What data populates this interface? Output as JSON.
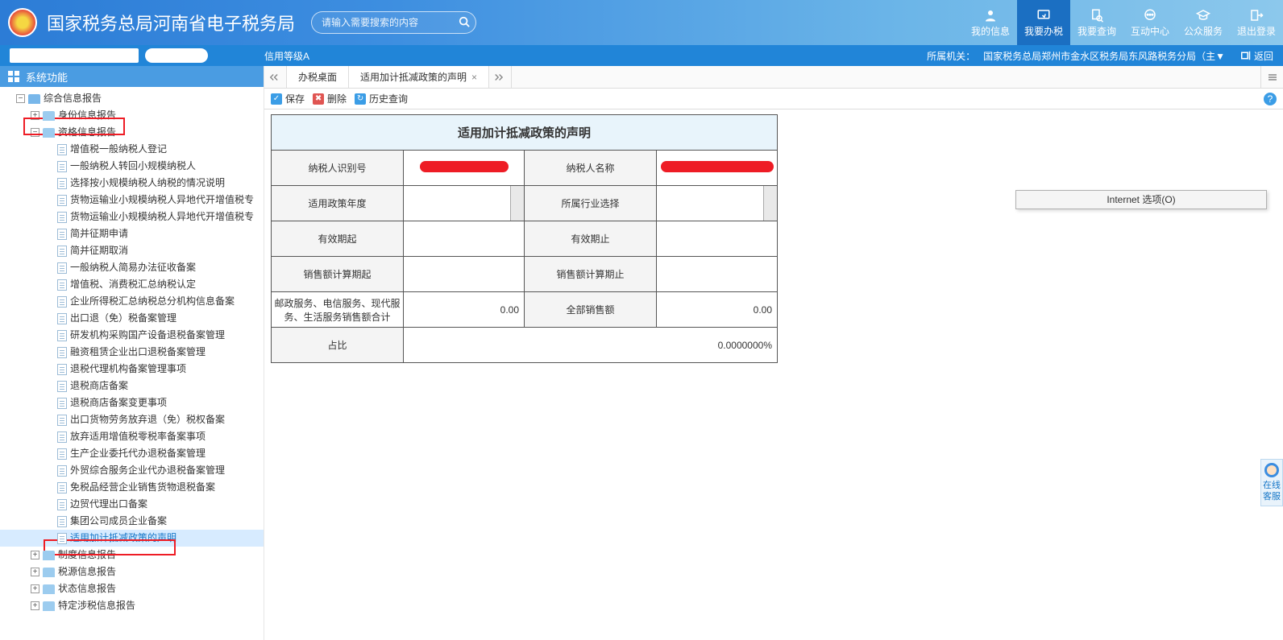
{
  "header": {
    "site_title": "国家税务总局河南省电子税务局",
    "search_placeholder": "请输入需要搜索的内容",
    "nav": [
      {
        "label": "我的信息",
        "icon": "person"
      },
      {
        "label": "我要办税",
        "icon": "cursor",
        "active": true
      },
      {
        "label": "我要查询",
        "icon": "search-doc"
      },
      {
        "label": "互动中心",
        "icon": "chat"
      },
      {
        "label": "公众服务",
        "icon": "grad"
      },
      {
        "label": "退出登录",
        "icon": "exit"
      }
    ]
  },
  "subbar": {
    "credit": "信用等级A",
    "org_label": "所属机关：",
    "org_name": "国家税务总局郑州市金水区税务局东风路税务分局（主▼",
    "return": "返回"
  },
  "sidebar": {
    "title": "系统功能",
    "roots": [
      {
        "label": "综合信息报告",
        "pm": "−",
        "indent": 0,
        "type": "folder"
      }
    ],
    "identity_node": {
      "label": "身份信息报告",
      "pm": "+",
      "indent": 1,
      "type": "folder-lite"
    },
    "qual_node": {
      "label": "资格信息报告",
      "pm": "−",
      "indent": 1,
      "type": "folder-lite"
    },
    "qual_children": [
      "增值税一般纳税人登记",
      "一般纳税人转回小规模纳税人",
      "选择按小规模纳税人纳税的情况说明",
      "货物运输业小规模纳税人异地代开增值税专",
      "货物运输业小规模纳税人异地代开增值税专",
      "简并征期申请",
      "简并征期取消",
      "一般纳税人简易办法征收备案",
      "增值税、消费税汇总纳税认定",
      "企业所得税汇总纳税总分机构信息备案",
      "出口退（免）税备案管理",
      "研发机构采购国产设备退税备案管理",
      "融资租赁企业出口退税备案管理",
      "退税代理机构备案管理事项",
      "退税商店备案",
      "退税商店备案变更事项",
      "出口货物劳务放弃退（免）税权备案",
      "放弃适用增值税零税率备案事项",
      "生产企业委托代办退税备案管理",
      "外贸综合服务企业代办退税备案管理",
      "免税品经营企业销售货物退税备案",
      "边贸代理出口备案",
      "集团公司成员企业备案",
      "适用加计抵减政策的声明"
    ],
    "tail_nodes": [
      {
        "label": "制度信息报告",
        "pm": "+"
      },
      {
        "label": "税源信息报告",
        "pm": "+"
      },
      {
        "label": "状态信息报告",
        "pm": "+"
      },
      {
        "label": "特定涉税信息报告",
        "pm": "+"
      }
    ]
  },
  "tabs": {
    "t1": "办税桌面",
    "t2": "适用加计抵减政策的声明"
  },
  "toolbar": {
    "save": "保存",
    "del": "删除",
    "hist": "历史查询"
  },
  "form": {
    "title": "适用加计抵减政策的声明",
    "r1_l1": "纳税人识别号",
    "r1_l2": "纳税人名称",
    "r2_l1": "适用政策年度",
    "r2_l2": "所属行业选择",
    "r3_l1": "有效期起",
    "r3_l2": "有效期止",
    "r4_l1": "销售额计算期起",
    "r4_l2": "销售额计算期止",
    "r5_l1": "邮政服务、电信服务、现代服务、生活服务销售额合计",
    "r5_v1": "0.00",
    "r5_l2": "全部销售额",
    "r5_v2": "0.00",
    "r6_l1": "占比",
    "r6_v": "0.0000000%"
  },
  "ie_popup": "Internet 选项(O)",
  "cs_float": "在线客服"
}
